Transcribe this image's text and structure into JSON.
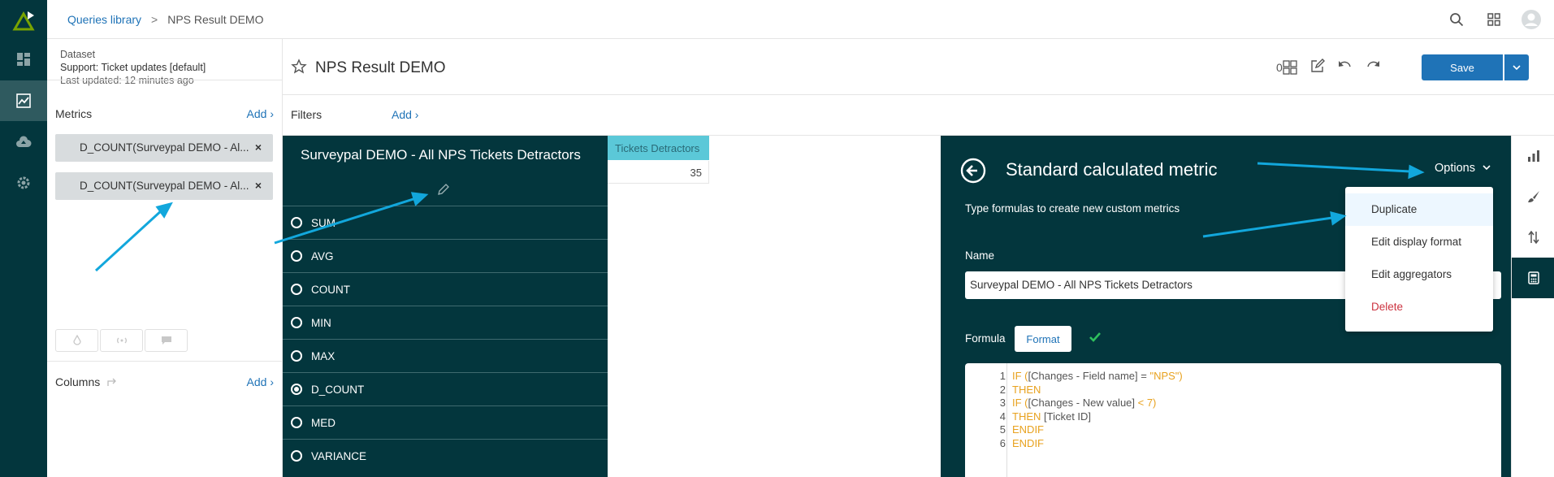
{
  "breadcrumb": {
    "library": "Queries library",
    "separator": ">",
    "current": "NPS Result DEMO"
  },
  "dataset": {
    "label": "Dataset",
    "name": "Support: Ticket updates [default]",
    "updated": "Last updated: 12 minutes ago"
  },
  "metrics": {
    "heading": "Metrics",
    "add": "Add ›",
    "items": [
      {
        "label": "D_COUNT(Surveypal DEMO - Al...",
        "remove": "×"
      },
      {
        "label": "D_COUNT(Surveypal DEMO - Al...",
        "remove": "×"
      }
    ]
  },
  "columns": {
    "heading": "Columns",
    "add": "Add ›"
  },
  "query": {
    "title": "NPS Result DEMO",
    "count": "0",
    "save": "Save"
  },
  "filters": {
    "heading": "Filters",
    "add": "Add ›"
  },
  "result": {
    "header": "Tickets Detractors",
    "value": "35"
  },
  "aggregator": {
    "title": "Surveypal DEMO - All NPS Tickets Detractors",
    "options": [
      "SUM",
      "AVG",
      "COUNT",
      "MIN",
      "MAX",
      "D_COUNT",
      "MED",
      "VARIANCE"
    ],
    "selected": "D_COUNT"
  },
  "calc": {
    "title": "Standard calculated metric",
    "options_label": "Options",
    "subtitle": "Type formulas to create new custom metrics",
    "name_label": "Name",
    "name_value": "Surveypal DEMO - All NPS Tickets Detractors",
    "formula_label": "Formula",
    "format_button": "Format",
    "code": [
      {
        "n": "1",
        "a": "IF (",
        "b": "[Changes - Field name] = ",
        "c": "\"NPS\")"
      },
      {
        "n": "2",
        "a": "THEN",
        "b": "",
        "c": ""
      },
      {
        "n": "3",
        "a": "IF (",
        "b": "[Changes - New value] ",
        "c": "< 7)"
      },
      {
        "n": "4",
        "a": "THEN ",
        "b": "[Ticket ID]",
        "c": ""
      },
      {
        "n": "5",
        "a": "ENDIF",
        "b": "",
        "c": ""
      },
      {
        "n": "6",
        "a": "ENDIF",
        "b": "",
        "c": ""
      }
    ]
  },
  "options_menu": [
    "Duplicate",
    "Edit display format",
    "Edit aggregators",
    "Delete"
  ],
  "colors": {
    "nav": "#03363d",
    "accent": "#1f73b7",
    "arrow": "#12a7dc",
    "code_keyword": "#e8a21f",
    "danger": "#cc3340"
  }
}
